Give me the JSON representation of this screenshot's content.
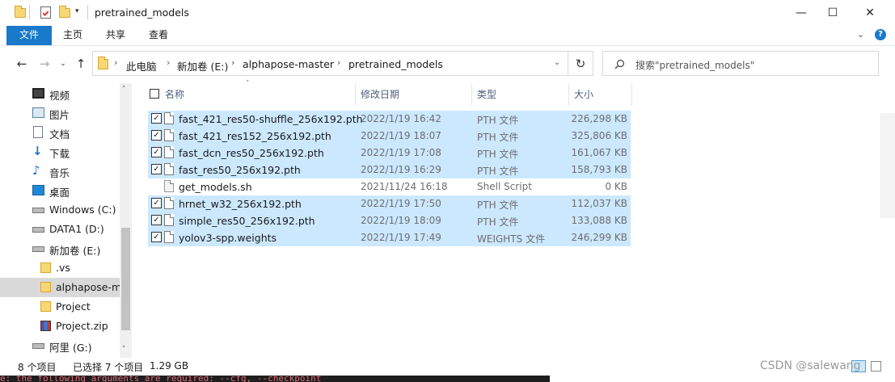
{
  "window": {
    "title": "pretrained_models",
    "minimize": "—",
    "maximize": "☐",
    "close": "✕"
  },
  "ribbon": {
    "tabs": [
      "文件",
      "主页",
      "共享",
      "查看"
    ]
  },
  "address": {
    "breadcrumb": [
      "此电脑",
      "新加卷 (E:)",
      "alphapose-master",
      "pretrained_models"
    ],
    "search_placeholder": "搜索\"pretrained_models\""
  },
  "sidebar": {
    "items": [
      {
        "label": "视频",
        "icon": "video-icon"
      },
      {
        "label": "图片",
        "icon": "pictures-icon"
      },
      {
        "label": "文档",
        "icon": "documents-icon"
      },
      {
        "label": "下载",
        "icon": "download-icon"
      },
      {
        "label": "音乐",
        "icon": "music-icon"
      },
      {
        "label": "桌面",
        "icon": "desktop-icon"
      },
      {
        "label": "Windows (C:)",
        "icon": "drive-icon"
      },
      {
        "label": "DATA1 (D:)",
        "icon": "drive-icon"
      },
      {
        "label": "新加卷 (E:)",
        "icon": "drive-icon"
      },
      {
        "label": ".vs",
        "icon": "folder-icon"
      },
      {
        "label": "alphapose-m",
        "icon": "folder-icon"
      },
      {
        "label": "Project",
        "icon": "folder-icon"
      },
      {
        "label": "Project.zip",
        "icon": "zip-icon"
      },
      {
        "label": "阿里 (G:)",
        "icon": "drive-icon"
      }
    ]
  },
  "columns": {
    "name": "名称",
    "modified": "修改日期",
    "type": "类型",
    "size": "大小"
  },
  "files": [
    {
      "name": "fast_421_res50-shuffle_256x192.pth",
      "date": "2022/1/19 16:42",
      "type": "PTH 文件",
      "size": "226,298 KB",
      "selected": true
    },
    {
      "name": "fast_421_res152_256x192.pth",
      "date": "2022/1/19 18:07",
      "type": "PTH 文件",
      "size": "325,806 KB",
      "selected": true
    },
    {
      "name": "fast_dcn_res50_256x192.pth",
      "date": "2022/1/19 17:08",
      "type": "PTH 文件",
      "size": "161,067 KB",
      "selected": true
    },
    {
      "name": "fast_res50_256x192.pth",
      "date": "2022/1/19 16:29",
      "type": "PTH 文件",
      "size": "158,793 KB",
      "selected": true
    },
    {
      "name": "get_models.sh",
      "date": "2021/11/24 16:18",
      "type": "Shell Script",
      "size": "0 KB",
      "selected": false
    },
    {
      "name": "hrnet_w32_256x192.pth",
      "date": "2022/1/19 17:50",
      "type": "PTH 文件",
      "size": "112,037 KB",
      "selected": true
    },
    {
      "name": "simple_res50_256x192.pth",
      "date": "2022/1/19 18:09",
      "type": "PTH 文件",
      "size": "133,088 KB",
      "selected": true
    },
    {
      "name": "yolov3-spp.weights",
      "date": "2022/1/19 17:49",
      "type": "WEIGHTS 文件",
      "size": "246,299 KB",
      "selected": true
    }
  ],
  "status": {
    "count": "8 个项目",
    "selected": "已选择 7 个项目",
    "size": "1.29 GB"
  },
  "watermark": "CSDN @salewang",
  "background_terminal": "e: the following arguments are required: --cfg, --checkpoint"
}
